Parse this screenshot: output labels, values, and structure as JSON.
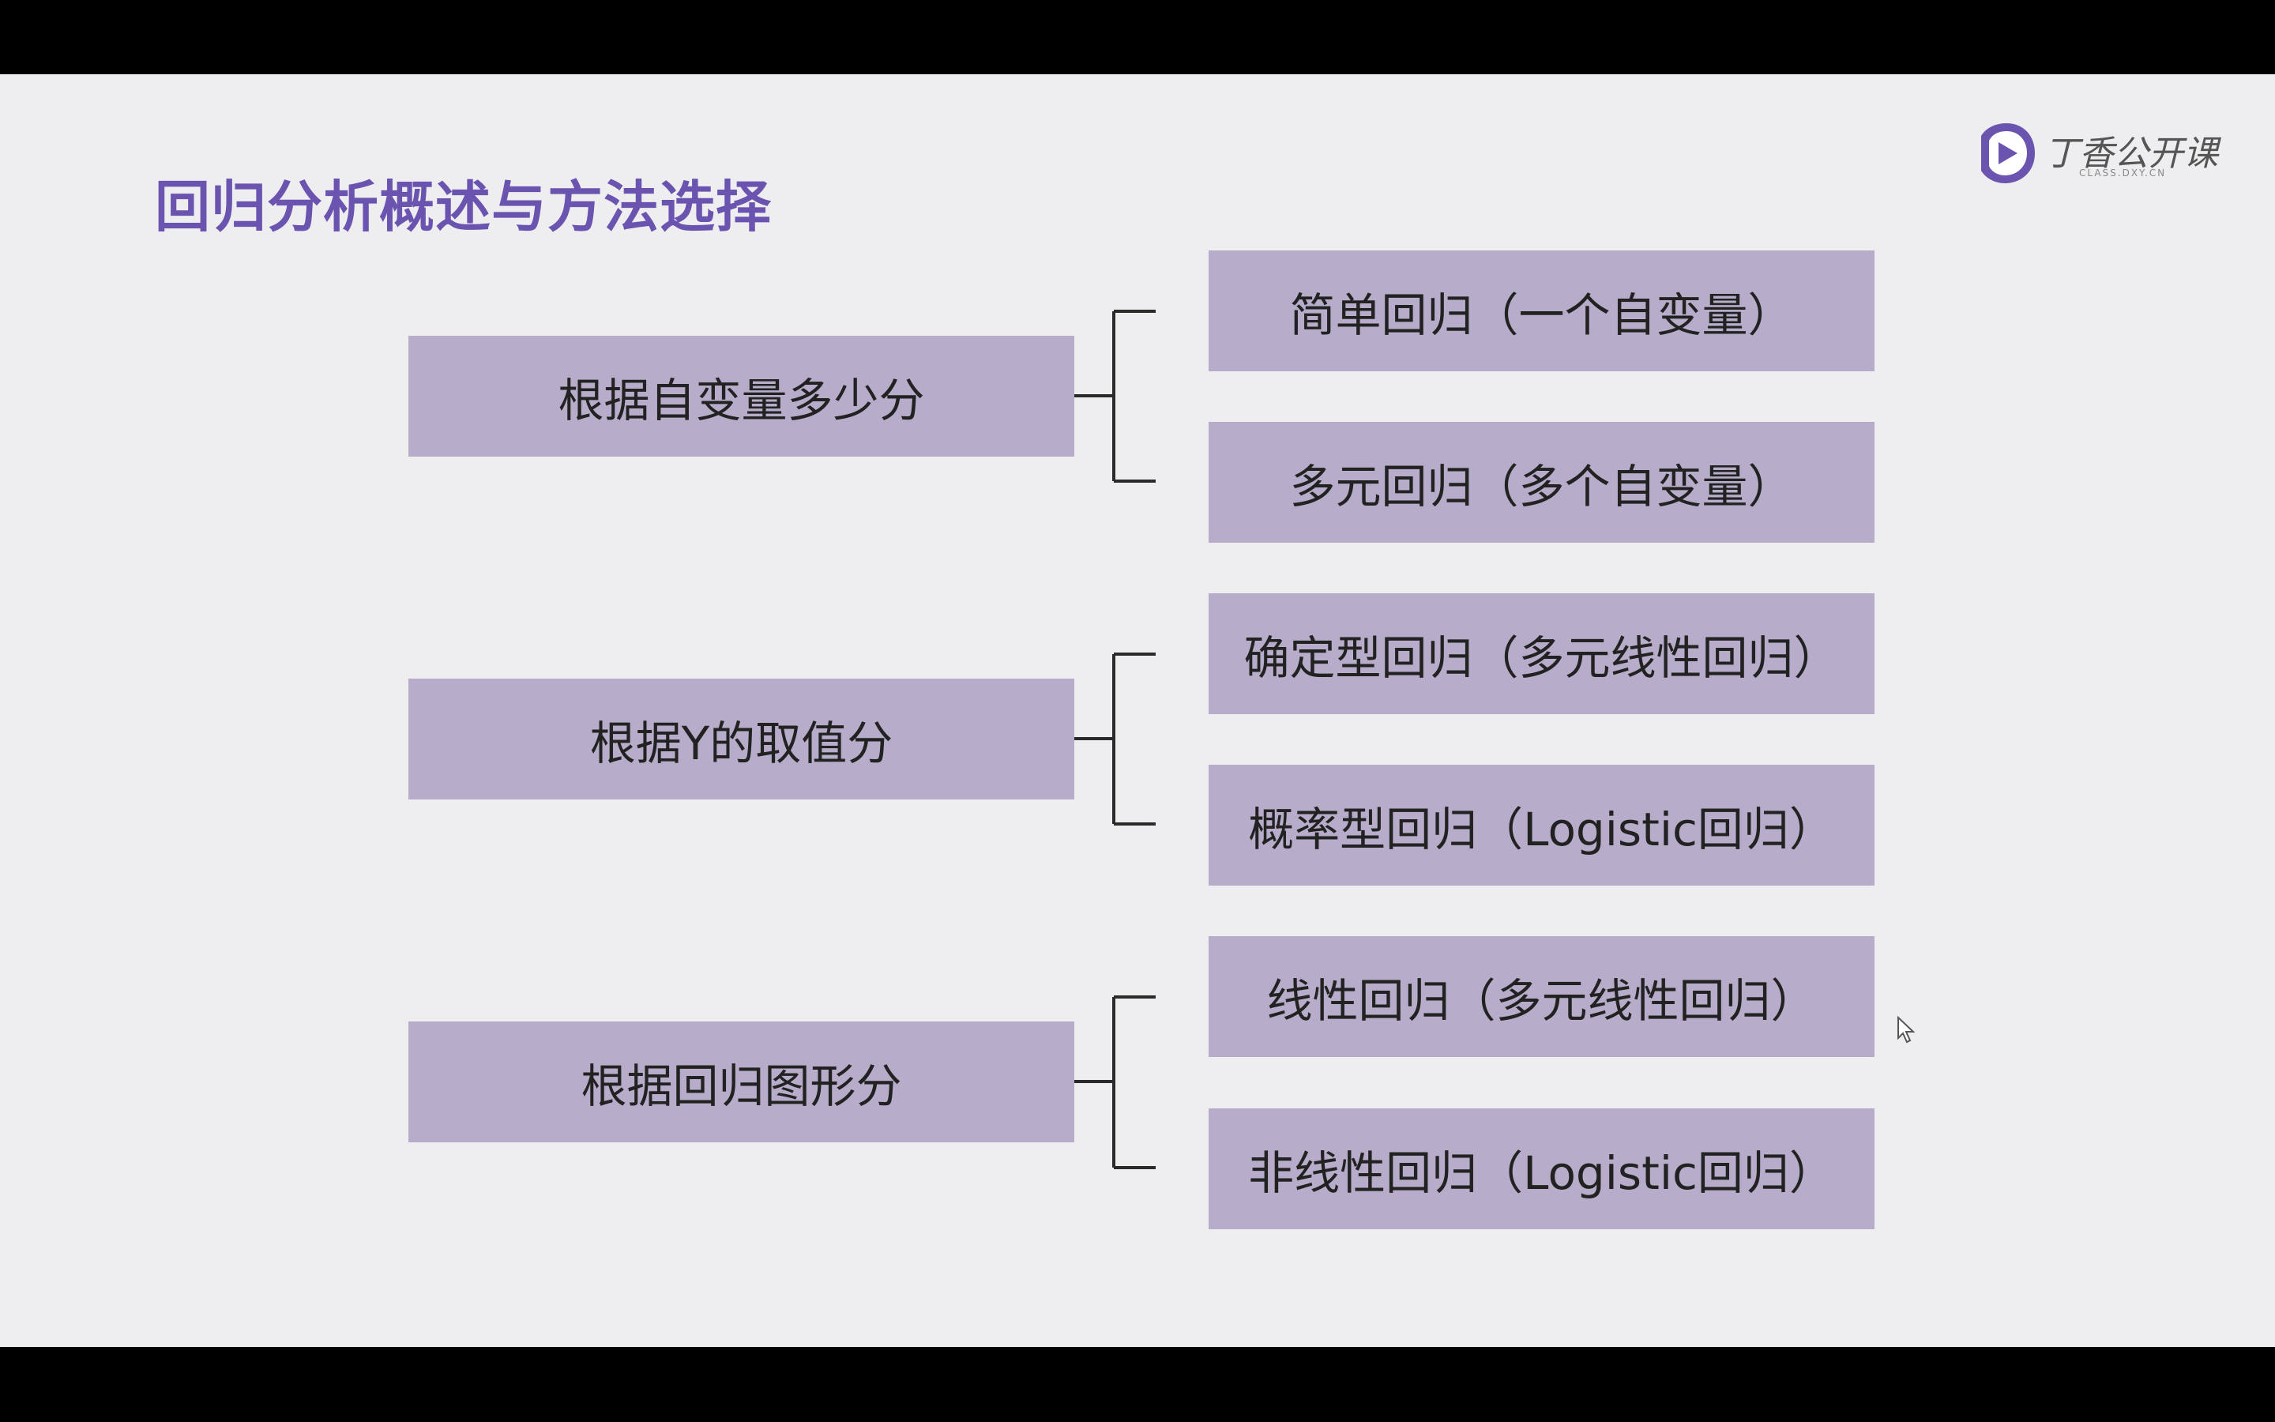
{
  "title": "回归分析概述与方法选择",
  "logo": {
    "name": "丁香公开课",
    "subtitle": "CLASS.DXY.CN",
    "brand_color": "#6a54b0"
  },
  "colors": {
    "box_fill": "#b7adca",
    "title": "#6a54b0",
    "connector": "#2a2a2a"
  },
  "groups": [
    {
      "label": "根据自变量多少分",
      "children": [
        "简单回归（一个自变量）",
        "多元回归（多个自变量）"
      ]
    },
    {
      "label": "根据Y的取值分",
      "children": [
        "确定型回归（多元线性回归）",
        "概率型回归（Logistic回归）"
      ]
    },
    {
      "label": "根据回归图形分",
      "children": [
        "线性回归（多元线性回归）",
        "非线性回归（Logistic回归）"
      ]
    }
  ]
}
